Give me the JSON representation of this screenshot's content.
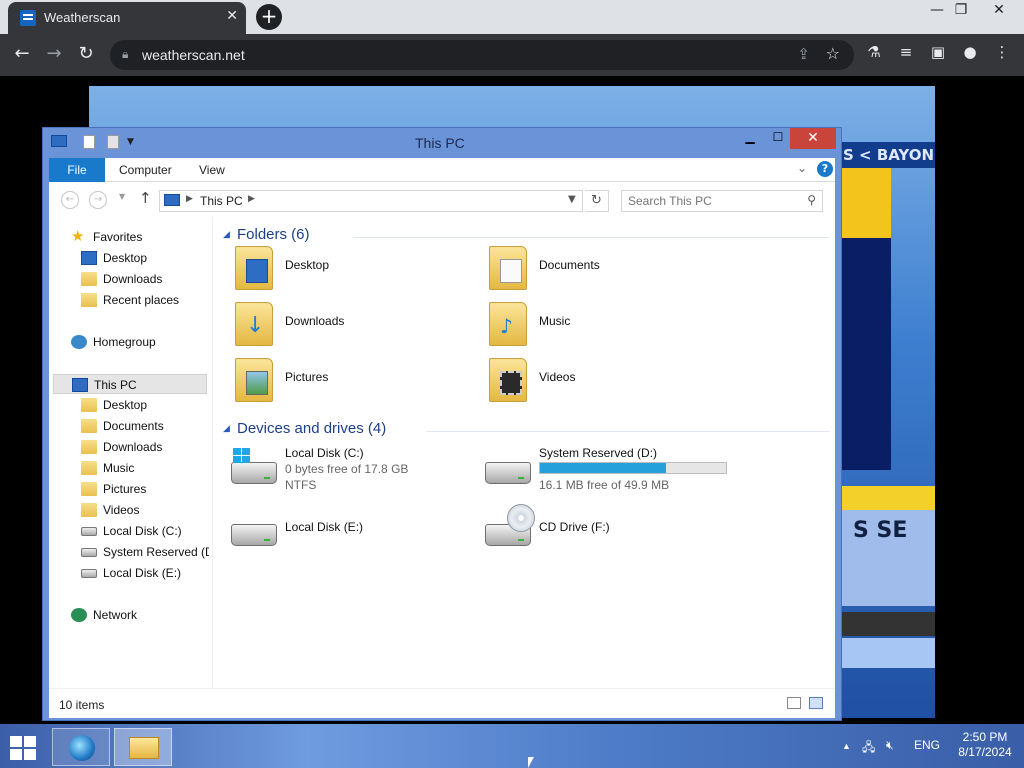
{
  "browser": {
    "tab_title": "Weatherscan",
    "new_tab_symbol": "+",
    "url": "weatherscan.net"
  },
  "weatherscan": {
    "ticker_text": "S < BAYONI",
    "panel_text": "S SE"
  },
  "explorer": {
    "window_title": "This PC",
    "ribbon_tabs": [
      "File",
      "Computer",
      "View"
    ],
    "address_crumb": "This PC",
    "search_placeholder": "Search This PC",
    "nav": {
      "favorites": "Favorites",
      "fav_items": [
        "Desktop",
        "Downloads",
        "Recent places"
      ],
      "homegroup": "Homegroup",
      "this_pc": "This PC",
      "pc_items": [
        "Desktop",
        "Documents",
        "Downloads",
        "Music",
        "Pictures",
        "Videos",
        "Local Disk (C:)",
        "System Reserved (D:)",
        "Local Disk (E:)"
      ],
      "network": "Network"
    },
    "folders_header": "Folders (6)",
    "folders": [
      "Desktop",
      "Documents",
      "Downloads",
      "Music",
      "Pictures",
      "Videos"
    ],
    "drives_header": "Devices and drives (4)",
    "drives": [
      {
        "name": "Local Disk (C:)",
        "free": "0 bytes free of 17.8 GB",
        "fs": "NTFS"
      },
      {
        "name": "System Reserved (D:)",
        "free": "16.1 MB free of 49.9 MB",
        "used_fraction": 0.68
      },
      {
        "name": "Local Disk (E:)"
      },
      {
        "name": "CD Drive (F:)"
      }
    ],
    "status_count": "10 items"
  },
  "taskbar": {
    "language": "ENG",
    "time": "2:50 PM",
    "date": "8/17/2024"
  },
  "colors": {
    "title_bar": "#6b93d8",
    "file_tab": "#1979ca",
    "close_button": "#c9443b",
    "capacity_bar": "#26a0da"
  }
}
